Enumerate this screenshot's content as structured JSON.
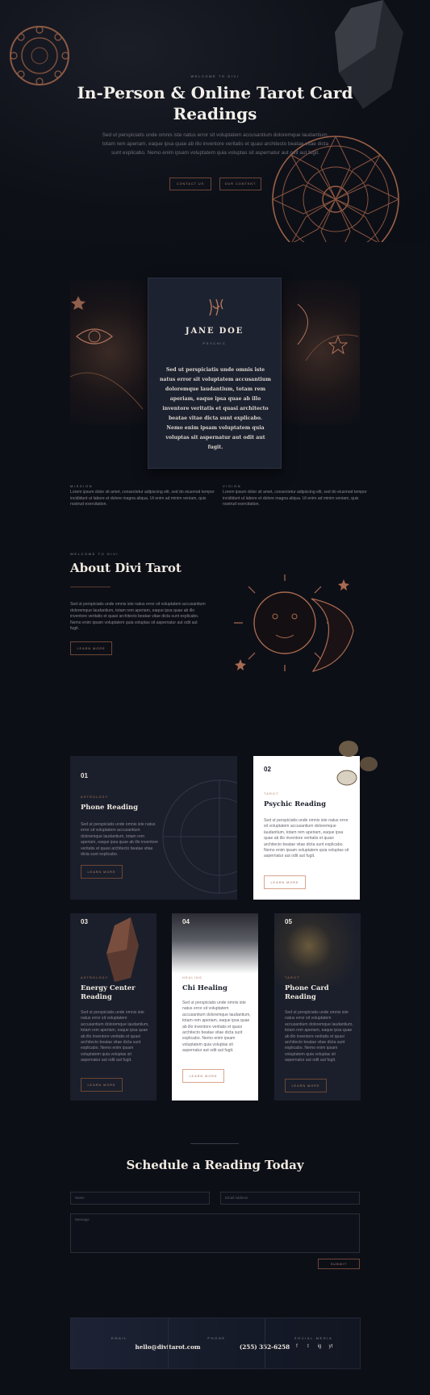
{
  "hero": {
    "eyebrow": "Welcome to Divi",
    "title": "In-Person & Online Tarot Card Readings",
    "text": "Sed ut perspiciatis unde omnis iste natus error sit voluptatem accusantium doloremque laudantium, totam rem aperiam, eaque ipsa quae ab illo inventore veritatis et quasi architecto beatae vitae dicta sunt explicabo. Nemo enim ipsam voluptatem quia voluptas sit aspernatur aut odit aut fugit.",
    "buttons": [
      "Contact Us",
      "Our Content"
    ]
  },
  "profile": {
    "name": "JANE DOE",
    "role": "Psychic",
    "bio": "Sed ut perspiciatis unde omnis iste natus error sit voluptatem accusantium doloremque laudantium, totam rem aperiam, eaque ipsa quae ab illo inventore veritatis et quasi architecto beatae vitae dicta sunt explicabo. Nemo enim ipsam voluptatem quia voluptas sit aspernatur aut odit aut fugit.",
    "mission_label": "Mission",
    "mission_text": "Lorem ipsum dolor sit amet, consectetur adipiscing elit, sed do eiusmod tempor incididunt ut labore et dolore magna aliqua. Ut enim ad minim veniam, quis nostrud exercitation.",
    "vision_label": "Vision",
    "vision_text": "Lorem ipsum dolor sit amet, consectetur adipiscing elit, sed do eiusmod tempor incididunt ut labore et dolore magna aliqua. Ut enim ad minim veniam, quis nostrud exercitation."
  },
  "about": {
    "eyebrow": "Welcome to Divi",
    "title": "About Divi Tarot",
    "text": "Sed ut perspiciatis unde omnis iste natus error sit voluptatem accusantium doloremque laudantium, totam rem aperiam, eaque ipsa quae ab illo inventore veritatis et quasi architecto beatae vitae dicta sunt explicabo. Nemo enim ipsam voluptatem quia voluptas sit aspernatur aut odit aut fugit.",
    "button": "Learn More"
  },
  "services": [
    {
      "num": "01",
      "category": "Astrology",
      "title": "Phone Reading",
      "text": "Sed ut perspiciatis unde omnis iste natus error sit voluptatem accusantium doloremque laudantium, totam rem aperiam, eaque ipsa quae ab illo inventore veritatis et quasi architecto beatae vitae dicta sunt explicabo.",
      "button": "Learn More"
    },
    {
      "num": "02",
      "category": "Tarot",
      "title": "Psychic Reading",
      "text": "Sed ut perspiciatis unde omnis iste natus error sit voluptatem accusantium doloremque laudantium, totam rem aperiam, eaque ipsa quae ab illo inventore veritatis et quasi architecto beatae vitae dicta sunt explicabo. Nemo enim ipsam voluptatem quia voluptas sit aspernatur aut odit aut fugit.",
      "button": "Learn More"
    },
    {
      "num": "03",
      "category": "Astrology",
      "title": "Energy Center Reading",
      "text": "Sed ut perspiciatis unde omnis iste natus error sit voluptatem accusantium doloremque laudantium, totam rem aperiam, eaque ipsa quae ab illo inventore veritatis et quasi architecto beatae vitae dicta sunt explicabo. Nemo enim ipsam voluptatem quia voluptas sit aspernatur aut odit aut fugit.",
      "button": "Learn More"
    },
    {
      "num": "04",
      "category": "Healing",
      "title": "Chi Healing",
      "text": "Sed ut perspiciatis unde omnis iste natus error sit voluptatem accusantium doloremque laudantium, totam rem aperiam, eaque ipsa quae ab illo inventore veritatis et quasi architecto beatae vitae dicta sunt explicabo. Nemo enim ipsam voluptatem quia voluptas sit aspernatur aut odit aut fugit.",
      "button": "Learn More"
    },
    {
      "num": "05",
      "category": "Tarot",
      "title": "Phone Card Reading",
      "text": "Sed ut perspiciatis unde omnis iste natus error sit voluptatem accusantium doloremque laudantium, totam rem aperiam, eaque ipsa quae ab illo inventore veritatis et quasi architecto beatae vitae dicta sunt explicabo. Nemo enim ipsam voluptatem quia voluptas sit aspernatur aut odit aut fugit.",
      "button": "Learn More"
    }
  ],
  "schedule": {
    "title": "Schedule a Reading Today",
    "name_placeholder": "Name",
    "email_placeholder": "Email Address",
    "message_placeholder": "Message",
    "submit": "Submit"
  },
  "footer": {
    "email_label": "Email",
    "email": "hello@divitarot.com",
    "phone_label": "Phone",
    "phone": "(255) 352-6258",
    "social_label": "Social Media",
    "social": [
      "f",
      "t",
      "ig",
      "yt"
    ]
  },
  "colors": {
    "accent": "#b3785e",
    "background": "#0d0f17",
    "card": "#1b1f2b"
  }
}
